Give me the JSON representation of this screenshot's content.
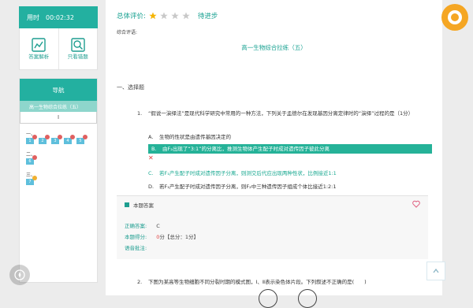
{
  "timer": {
    "label": "用时",
    "value": "00:02:32"
  },
  "tools": [
    {
      "label": "答案解析",
      "icon": "chart-icon"
    },
    {
      "label": "只看错题",
      "icon": "search-icon"
    }
  ],
  "nav": {
    "title": "导航",
    "paper": "高一生物综合拉练（五）",
    "tab": "I",
    "groups": [
      {
        "label": "一、",
        "items": [
          "1",
          "2",
          "3",
          "4",
          "5"
        ]
      },
      {
        "label": "二、",
        "items": [
          "6"
        ]
      },
      {
        "label": "三、",
        "items": [
          "7"
        ]
      }
    ]
  },
  "evaluation": {
    "label": "总体评价:",
    "verdict": "待进步",
    "stars_filled": 1,
    "stars_total": 4
  },
  "comment_label": "综合评语:",
  "paper_title": "高一生物综合拉练（五）",
  "section_title": "一、选择题",
  "question1": {
    "num": "1.",
    "stem": "“假说一演绎法”是现代科学研究中常用的一种方法，下列关于孟德尔在发现基因分离定律时的“演绎”过程的是（1分）",
    "options": [
      {
        "letter": "A.",
        "text": "生物的性状是由遗传基因决定的"
      },
      {
        "letter": "B.",
        "text": "由F₂出现了“3:1”的分离比，推测生物体产生配子时成对遗传因子彼此分离"
      },
      {
        "letter": "C.",
        "text": "若F₁产生配子时成对遗传因子分离，则测交后代应出现两种性状，比例接近1:1"
      },
      {
        "letter": "D.",
        "text": "若F₁产生配子时成对遗传因子分离，则F₂中三种遗传因子组成个体比接近1:2:1"
      }
    ]
  },
  "answer": {
    "heading": "本题答案",
    "correct_label": "正确答案:",
    "correct_value": "C",
    "score_label": "本题得分:",
    "score_value": "0",
    "score_suffix": "分【总分：1分】",
    "note_label": "语音批注:"
  },
  "question2": {
    "num": "2.",
    "stem": "下图为某高等生物细胞不同分裂时期的模式图，Ⅰ、Ⅱ表示染色体片段。下列叙述不正确的是(　　)"
  },
  "colors": {
    "accent": "#23b0a0",
    "wrong": "#e04040",
    "star": "#f5b400"
  }
}
